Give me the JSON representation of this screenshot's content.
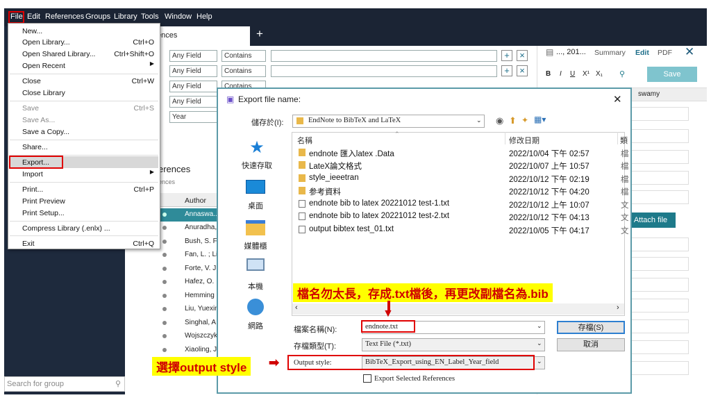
{
  "menubar": {
    "items": [
      "File",
      "Edit",
      "References",
      "Groups",
      "Library",
      "Tools",
      "Window",
      "Help"
    ]
  },
  "file_menu": {
    "items": [
      {
        "label": "New...",
        "shortcut": "",
        "disabled": false
      },
      {
        "label": "Open Library...",
        "shortcut": "Ctrl+O",
        "disabled": false
      },
      {
        "label": "Open Shared Library...",
        "shortcut": "Ctrl+Shift+O",
        "disabled": false
      },
      {
        "label": "Open Recent",
        "shortcut": "",
        "disabled": false
      },
      {
        "label": "Close",
        "shortcut": "Ctrl+W",
        "disabled": false
      },
      {
        "label": "Close Library",
        "shortcut": "",
        "disabled": false
      },
      {
        "label": "Save",
        "shortcut": "Ctrl+S",
        "disabled": true
      },
      {
        "label": "Save As...",
        "shortcut": "",
        "disabled": true
      },
      {
        "label": "Save a Copy...",
        "shortcut": "",
        "disabled": false
      },
      {
        "label": "Share...",
        "shortcut": "",
        "disabled": false
      },
      {
        "label": "Export...",
        "shortcut": "",
        "disabled": false
      },
      {
        "label": "Import",
        "shortcut": "",
        "disabled": false
      },
      {
        "label": "Print...",
        "shortcut": "Ctrl+P",
        "disabled": false
      },
      {
        "label": "Print Preview",
        "shortcut": "",
        "disabled": false
      },
      {
        "label": "Print Setup...",
        "shortcut": "",
        "disabled": false
      },
      {
        "label": "Compress Library (.enlx) ...",
        "shortcut": "",
        "disabled": false
      },
      {
        "label": "Exit",
        "shortcut": "Ctrl+Q",
        "disabled": false
      }
    ]
  },
  "tab": {
    "label": "ences",
    "add": "+"
  },
  "search_rows": [
    {
      "field": "Any Field",
      "op": "Contains"
    },
    {
      "field": "Any Field",
      "op": "Contains"
    },
    {
      "field": "Any Field",
      "op": "Contains"
    },
    {
      "field": "Any Field",
      "op": ""
    },
    {
      "field": "Year",
      "op": ""
    }
  ],
  "references": {
    "title": "erences",
    "subtitle": "ences",
    "author_header": "Author",
    "authors": [
      "Annaswa...",
      "Anuradha,",
      "Bush, S. F.",
      "Fan, L. ; Li,",
      "Forte, V. J.",
      "Hafez, O.",
      "Hemming",
      "Liu, Yuexin",
      "Singhal, A",
      "Wojszczyk",
      "Xiaoling, J"
    ]
  },
  "right_panel": {
    "title": "..., 201...",
    "tabs": [
      "Summary",
      "Edit",
      "PDF"
    ],
    "save_label": "Save",
    "format_buttons": [
      "B",
      "I",
      "U",
      "X¹",
      "X₁"
    ],
    "field_value": "swamy",
    "attach_label": "Attach file"
  },
  "search_group_placeholder": "Search for group",
  "dialog": {
    "title": "Export file name:",
    "save_in_label": "儲存於(I):",
    "save_in_value": "EndNote to BibTeX and LaTeX",
    "col_name": "名稱",
    "col_date": "修改日期",
    "col_type": "類",
    "places": [
      "快速存取",
      "桌面",
      "媒體櫃",
      "本機",
      "網路"
    ],
    "files": [
      {
        "name": "endnote 匯入latex .Data",
        "date": "2022/10/04 下午 02:57",
        "kind": "folder",
        "type": "檔"
      },
      {
        "name": "LateX論文格式",
        "date": "2022/10/07 上午 10:57",
        "kind": "folder",
        "type": "檔"
      },
      {
        "name": "style_ieeetran",
        "date": "2022/10/12 下午 02:19",
        "kind": "folder",
        "type": "檔"
      },
      {
        "name": "参考資料",
        "date": "2022/10/12 下午 04:20",
        "kind": "folder",
        "type": "檔"
      },
      {
        "name": "endnote bib to latex 20221012 test-1.txt",
        "date": "2022/10/12 上午 10:07",
        "kind": "doc",
        "type": "文"
      },
      {
        "name": "endnote bib to latex 20221012 test-2.txt",
        "date": "2022/10/12 下午 04:13",
        "kind": "doc",
        "type": "文"
      },
      {
        "name": "output bibtex test_01.txt",
        "date": "2022/10/05 下午 04:17",
        "kind": "doc",
        "type": "文"
      }
    ],
    "filename_label": "檔案名稱(N):",
    "filename_value": "endnote.txt",
    "filetype_label": "存檔類型(T):",
    "filetype_value": "Text File (*.txt)",
    "style_label": "Output style:",
    "style_value": "BibTeX_Export_using_EN_Label_Year_field",
    "export_selected": "Export Selected References",
    "save_button": "存檔(S)",
    "cancel_button": "取消"
  },
  "annotations": {
    "filename_note": "檔名勿太長，存成.txt檔後，再更改副檔名為.bib",
    "style_note": "選擇output style"
  },
  "colors": {
    "accent": "#1e7a8a",
    "annotation_bg": "#ffff00",
    "annotation_text": "#d00000"
  }
}
